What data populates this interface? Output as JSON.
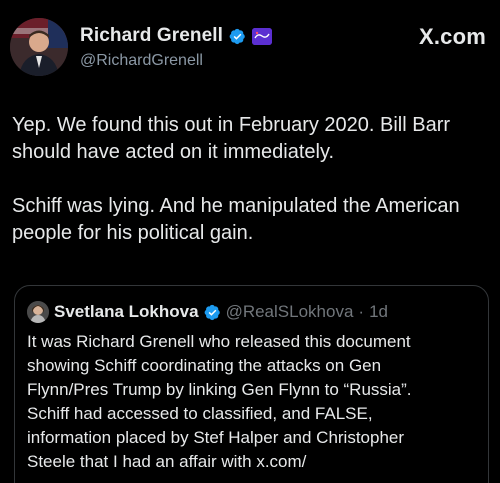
{
  "header": {
    "display_name": "Richard Grenell",
    "handle": "@RichardGrenell",
    "brand": "X.com"
  },
  "tweet": {
    "paragraphs": [
      "Yep. We found this out in February 2020. Bill Barr should have acted on it immediately.",
      "Schiff was lying. And he manipulated the American people for his political gain."
    ]
  },
  "quote": {
    "display_name": "Svetlana Lokhova",
    "handle": "@RealSLokhova",
    "separator": "·",
    "time": "1d",
    "text": "It was Richard Grenell who released this document\nshowing Schiff coordinating the attacks on Gen\nFlynn/Pres Trump by linking Gen Flynn to “Russia”.\nSchiff had accessed to classified, and FALSE,\ninformation placed by Stef Halper and Christopher\nSteele that I had an affair with x.com/"
  },
  "icons": {
    "verified": "verified-badge-icon",
    "affiliate": "affiliate-badge-icon"
  },
  "colors": {
    "background": "#000000",
    "text": "#e7e9ea",
    "secondary_text": "#8b98a5",
    "verified_blue": "#1d9bf0",
    "border": "#333639"
  }
}
